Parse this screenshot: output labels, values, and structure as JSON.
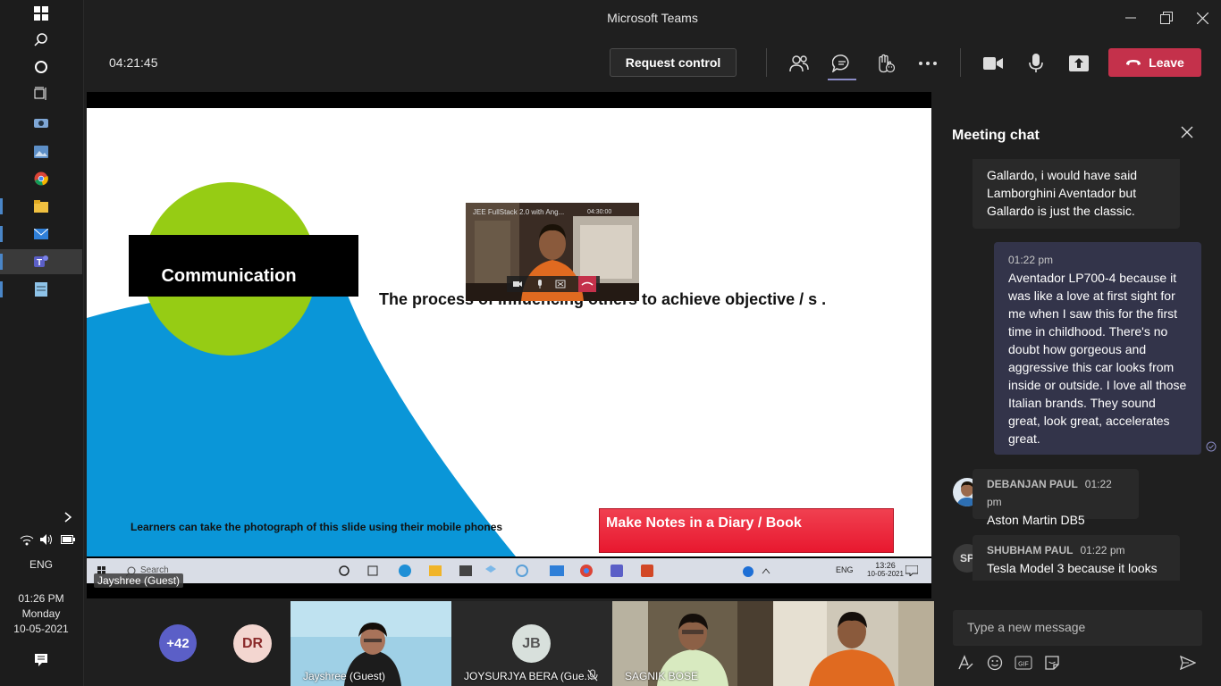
{
  "window": {
    "title": "Microsoft Teams"
  },
  "header": {
    "timer": "04:21:45",
    "request_control": "Request control",
    "leave": "Leave"
  },
  "slide": {
    "title": "Communication",
    "body": "The process of influencing others to achieve objective / s .",
    "note": "Learners can take the photograph of this slide using their mobile phones",
    "button": "Make Notes in a Diary / Book",
    "colors": {
      "green": "#96cc14",
      "blue": "#0a96d8",
      "red": "#ee2a3a"
    }
  },
  "pip": {
    "title": "JEE FullStack 2.0 with Ang...",
    "time": "04:30:00"
  },
  "inner_taskbar": {
    "search": "Search",
    "lang": "ENG",
    "time": "13:26",
    "date": "10-05-2021"
  },
  "presenter_label": "Jayshree (Guest)",
  "participants": {
    "more": "+42",
    "tiles": [
      {
        "initials": "DR"
      },
      {
        "name": "Jayshree (Guest)"
      },
      {
        "initials": "JB",
        "name": "JOYSURJYA BERA (Gue..."
      },
      {
        "name": "SAGNIK BOSE"
      },
      {
        "name": ""
      }
    ]
  },
  "chat": {
    "title": "Meeting chat",
    "messages": [
      {
        "text": "Gallardo, i would have said Lamborghini Aventador but Gallardo is just the classic."
      },
      {
        "time": "01:22 pm",
        "text": "Aventador LP700-4 because it was like a love at first sight for me when I saw this for the first time in childhood. There's no doubt how gorgeous and aggressive this car looks from inside or outside. I love all those Italian brands. They sound great, look great, accelerates great."
      },
      {
        "author": "DEBANJAN PAUL",
        "time": "01:22 pm",
        "text": "Aston Martin DB5"
      },
      {
        "author": "SHUBHAM PAUL",
        "initials": "SP",
        "time": "01:22 pm",
        "text": "Tesla Model 3 because it looks"
      }
    ],
    "compose_placeholder": "Type a new message"
  },
  "system_taskbar": {
    "lang": "ENG",
    "time": "01:26 PM",
    "day": "Monday",
    "date": "10-05-2021"
  }
}
